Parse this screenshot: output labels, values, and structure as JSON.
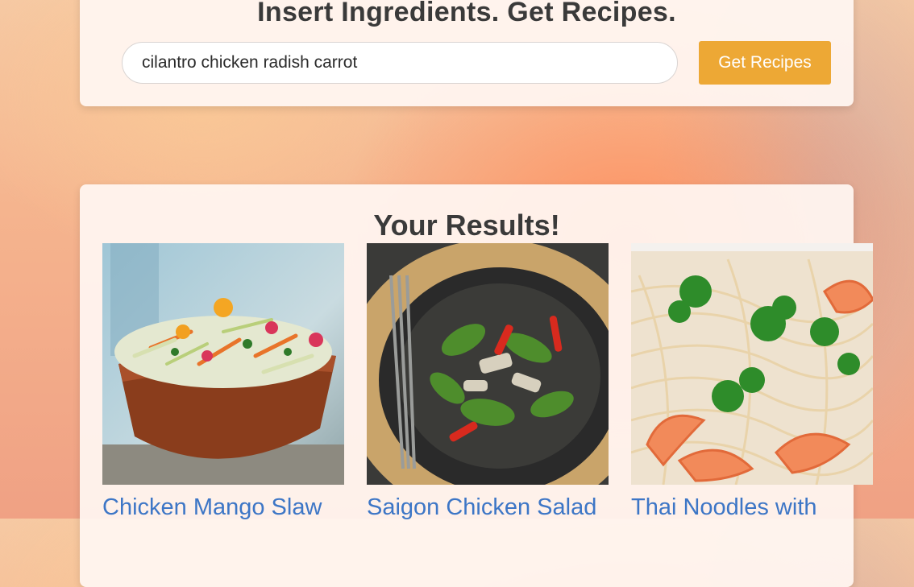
{
  "search": {
    "heading": "Insert Ingredients. Get Recipes.",
    "query": "cilantro chicken radish carrot",
    "button_label": "Get Recipes"
  },
  "results": {
    "heading": "Your Results!",
    "recipes": [
      {
        "title": "Chicken Mango Slaw"
      },
      {
        "title": "Saigon Chicken Salad"
      },
      {
        "title": "Thai Noodles with"
      }
    ]
  },
  "colors": {
    "button": "#eda835",
    "link": "#3d76c6"
  }
}
